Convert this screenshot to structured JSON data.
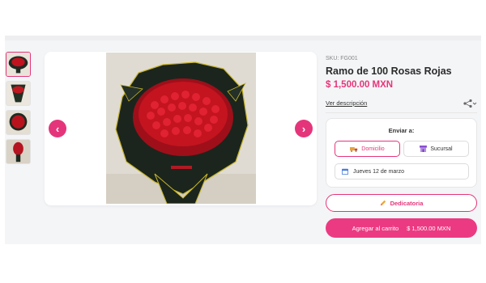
{
  "product": {
    "sku": "SKU: FG001",
    "title": "Ramo de 100 Rosas Rojas",
    "price": "$ 1,500.00 MXN",
    "description_link": "Ver descripción"
  },
  "gallery": {
    "thumbnail_count": 4,
    "active_index": 0
  },
  "delivery": {
    "label": "Enviar a:",
    "options": [
      {
        "label": "Domicilio",
        "icon": "truck-icon",
        "selected": true
      },
      {
        "label": "Sucursal",
        "icon": "store-icon",
        "selected": false
      }
    ],
    "date": {
      "label": "Jueves 12 de marzo",
      "icon": "calendar-icon"
    }
  },
  "actions": {
    "dedication_label": "Dedicatoria",
    "dedication_icon": "pencil-icon",
    "cart_label": "Agregar al carrito",
    "cart_price": "$ 1,500.00 MXN"
  },
  "colors": {
    "accent": "#e5357a",
    "cart_button": "#ec3a82",
    "background_panel": "#f4f5f7"
  }
}
